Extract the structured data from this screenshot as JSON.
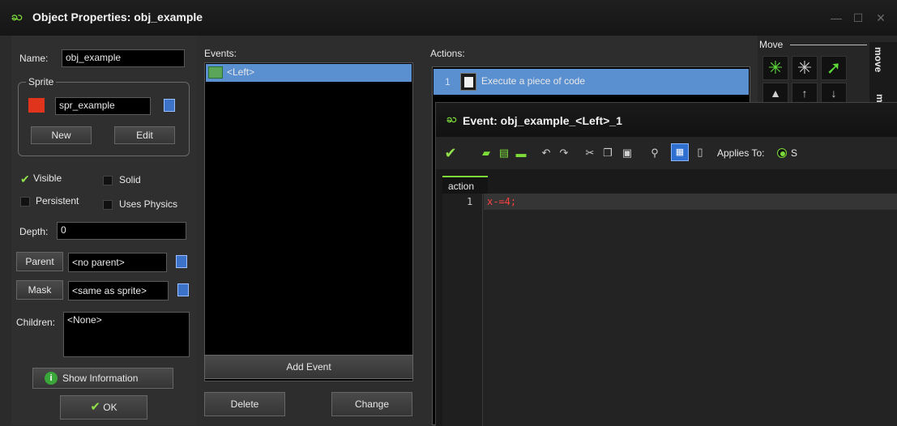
{
  "window": {
    "title": "Object Properties: obj_example",
    "logo": "ႀ",
    "btn_min": "—",
    "btn_max": "☐",
    "btn_close": "✕"
  },
  "left": {
    "name_label": "Name:",
    "name_value": "obj_example",
    "sprite_group_label": "Sprite",
    "sprite_value": "spr_example",
    "new_label": "New",
    "edit_label": "Edit",
    "visible_label": "Visible",
    "solid_label": "Solid",
    "persistent_label": "Persistent",
    "uses_physics_label": "Uses Physics",
    "depth_label": "Depth:",
    "depth_value": "0",
    "parent_label": "Parent",
    "parent_value": "<no parent>",
    "mask_label": "Mask",
    "mask_value": "<same as sprite>",
    "children_label": "Children:",
    "children_value": "<None>",
    "show_info_label": "Show Information",
    "ok_label": "OK"
  },
  "events": {
    "header": "Events:",
    "items": [
      {
        "label": "<Left>"
      }
    ],
    "add_label": "Add Event",
    "delete_label": "Delete",
    "change_label": "Change"
  },
  "actions": {
    "header": "Actions:",
    "items": [
      {
        "index": "1",
        "label": "Execute a piece of code"
      }
    ]
  },
  "move_panel": {
    "header": "Move",
    "tab_label": "move",
    "tab2_label": "m"
  },
  "code_editor": {
    "title": "Event: obj_example_<Left>_1",
    "applies_to_label": "Applies To:",
    "applies_value": "S",
    "tab_label": "action",
    "lines": [
      {
        "number": "1",
        "code": "x-=4;"
      }
    ]
  },
  "colors": {
    "accent_green": "#7ddc3a",
    "selection_blue": "#5a8fd0",
    "sprite_red": "#e0341c",
    "code_red": "#ff4040"
  }
}
